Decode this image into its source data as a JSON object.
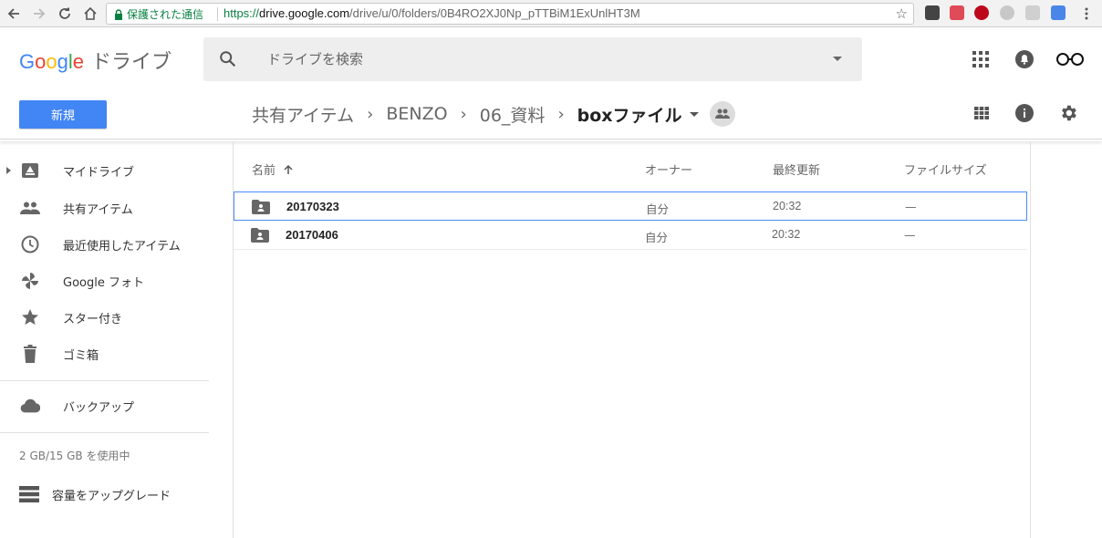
{
  "browser": {
    "secure_label": "保護された通信",
    "url_scheme": "https://",
    "url_host": "drive.google.com",
    "url_path": "/drive/u/0/folders/0B4RO2XJ0Np_pTTBiM1ExUnlHT3M"
  },
  "header": {
    "logo_letters": [
      "G",
      "o",
      "o",
      "g",
      "l",
      "e"
    ],
    "product": "ドライブ",
    "search_placeholder": "ドライブを検索"
  },
  "toolbar": {
    "new_label": "新規",
    "breadcrumb": [
      "共有アイテム",
      "BENZO",
      "06_資料"
    ],
    "current_folder": "boxファイル"
  },
  "sidebar": {
    "items": [
      {
        "label": "マイドライブ",
        "icon": "drive-icon"
      },
      {
        "label": "共有アイテム",
        "icon": "people-icon"
      },
      {
        "label": "最近使用したアイテム",
        "icon": "clock-icon"
      },
      {
        "label": "Google フォト",
        "icon": "pinwheel-icon"
      },
      {
        "label": "スター付き",
        "icon": "star-icon"
      },
      {
        "label": "ゴミ箱",
        "icon": "trash-icon"
      }
    ],
    "backup_label": "バックアップ",
    "quota": "2 GB/15 GB を使用中",
    "upgrade_label": "容量をアップグレード"
  },
  "list": {
    "columns": {
      "name": "名前",
      "owner": "オーナー",
      "modified": "最終更新",
      "size": "ファイルサイズ"
    },
    "rows": [
      {
        "name": "20170323",
        "owner": "自分",
        "modified": "20:32",
        "size": "—"
      },
      {
        "name": "20170406",
        "owner": "自分",
        "modified": "20:32",
        "size": "—"
      }
    ]
  },
  "colors": {
    "accent": "#4285f4",
    "secure_green": "#0b8043",
    "google_blue": "#4285f4",
    "google_red": "#ea4335",
    "google_yellow": "#fbbc05",
    "google_green": "#34a853"
  }
}
